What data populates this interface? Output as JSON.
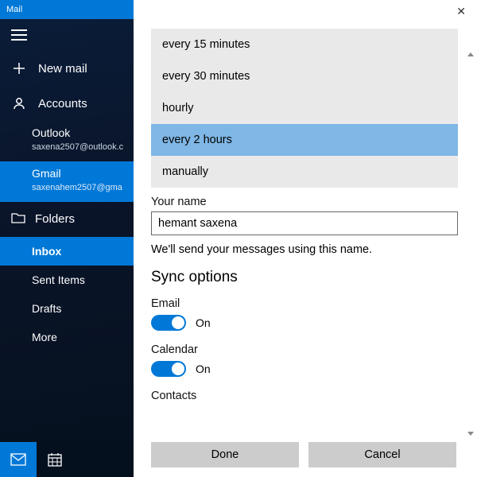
{
  "titlebar": "Mail",
  "sidebar": {
    "newmail": "New mail",
    "accounts_label": "Accounts",
    "accounts": [
      {
        "name": "Outlook",
        "email": "saxena2507@outlook.c"
      },
      {
        "name": "Gmail",
        "email": "saxenahem2507@gma"
      }
    ],
    "folders_label": "Folders",
    "folders": [
      "Inbox",
      "Sent Items",
      "Drafts",
      "More"
    ]
  },
  "pane": {
    "dropdown": [
      "every 15 minutes",
      "every 30 minutes",
      "hourly",
      "every 2 hours",
      "manually"
    ],
    "name_label": "Your name",
    "name_value": "hemant saxena",
    "name_hint": "We'll send your messages using this name.",
    "sync_header": "Sync options",
    "toggles": [
      {
        "label": "Email",
        "state": "On"
      },
      {
        "label": "Calendar",
        "state": "On"
      }
    ],
    "contacts_label": "Contacts",
    "buttons": {
      "done": "Done",
      "cancel": "Cancel"
    }
  }
}
